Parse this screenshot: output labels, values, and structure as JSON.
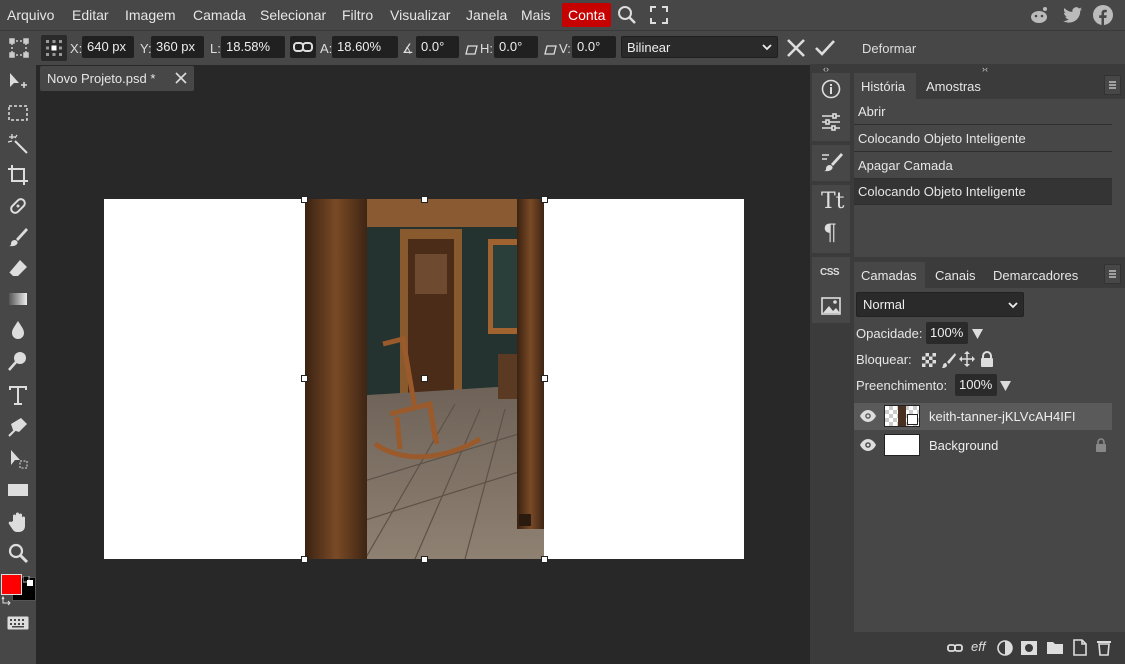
{
  "menu": {
    "items": [
      "Arquivo",
      "Editar",
      "Imagem",
      "Camada",
      "Selecionar",
      "Filtro",
      "Visualizar",
      "Janela",
      "Mais"
    ],
    "account": "Conta"
  },
  "options": {
    "x_label": "X:",
    "x_value": "640 px",
    "y_label": "Y:",
    "y_value": "360 px",
    "w_label": "L:",
    "w_value": "18.58%",
    "h_label": "A:",
    "h_value": "18.60%",
    "rot_value": "0.0°",
    "skew_h_label": "H:",
    "skew_h_value": "0.0°",
    "skew_v_label": "V:",
    "skew_v_value": "0.0°",
    "interpolation": "Bilinear",
    "warp_label": "Deformar"
  },
  "document": {
    "tab_title": "Novo Projeto.psd *"
  },
  "history": {
    "tabs": [
      "História",
      "Amostras"
    ],
    "items": [
      "Abrir",
      "Colocando Objeto Inteligente",
      "Apagar Camada",
      "Colocando Objeto Inteligente"
    ]
  },
  "layers": {
    "tabs": [
      "Camadas",
      "Canais",
      "Demarcadores"
    ],
    "blend_mode": "Normal",
    "opacity_label": "Opacidade:",
    "opacity_value": "100%",
    "lock_label": "Bloquear:",
    "fill_label": "Preenchimento:",
    "fill_value": "100%",
    "items": [
      "keith-tanner-jKLVcAH4IFI",
      "Background"
    ]
  },
  "colors": {
    "foreground": "#ff0000",
    "background": "#000000",
    "accent": "#c70000"
  }
}
